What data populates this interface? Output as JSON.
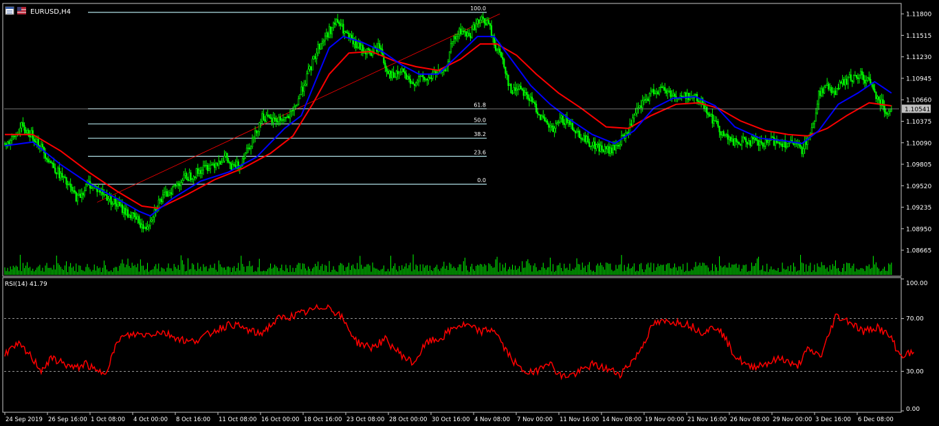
{
  "window": {
    "title": "EURUSD,H4",
    "icons": [
      "chart-window-icon",
      "flag-icon"
    ]
  },
  "colors": {
    "background": "#000000",
    "frame": "#c8c8c8",
    "candle_up": "#00ff00",
    "candle_down": "#00ff00",
    "ma_fast": "#0000ff",
    "ma_slow": "#ff0000",
    "fib": "#b0e0e6",
    "trendline": "#ff0000",
    "rsi": "#ff0000",
    "volume": "#00ff00",
    "price_tag_bg": "#c0c0c0",
    "text": "#ffffff"
  },
  "chart_data": {
    "type": "candlestick",
    "symbol": "EURUSD",
    "timeframe": "H4",
    "ylim": [
      1.0852,
      1.1192
    ],
    "price_ticks": [
      "1.11800",
      "1.11515",
      "1.11230",
      "1.10945",
      "1.10660",
      "1.10375",
      "1.10090",
      "1.09805",
      "1.09520",
      "1.09235",
      "1.08950",
      "1.08665"
    ],
    "current_price": "1.10541",
    "time_labels": [
      "24 Sep 2019",
      "26 Sep 16:00",
      "1 Oct 08:00",
      "4 Oct 00:00",
      "8 Oct 16:00",
      "11 Oct 08:00",
      "16 Oct 00:00",
      "18 Oct 16:00",
      "23 Oct 08:00",
      "28 Oct 00:00",
      "30 Oct 16:00",
      "4 Nov 08:00",
      "7 Nov 00:00",
      "11 Nov 16:00",
      "14 Nov 08:00",
      "19 Nov 00:00",
      "21 Nov 16:00",
      "26 Nov 08:00",
      "29 Nov 00:00",
      "3 Dec 16:00",
      "6 Dec 08:00"
    ],
    "price_path": [
      [
        0,
        1.1008
      ],
      [
        5,
        1.1012
      ],
      [
        12,
        1.103
      ],
      [
        22,
        1.1015
      ],
      [
        32,
        1.0985
      ],
      [
        42,
        1.096
      ],
      [
        52,
        1.0935
      ],
      [
        60,
        1.0955
      ],
      [
        68,
        1.0945
      ],
      [
        78,
        1.093
      ],
      [
        88,
        1.0915
      ],
      [
        96,
        1.0905
      ],
      [
        100,
        1.0893
      ],
      [
        104,
        1.0908
      ],
      [
        110,
        1.093
      ],
      [
        118,
        1.0945
      ],
      [
        128,
        1.0962
      ],
      [
        136,
        1.0968
      ],
      [
        142,
        1.0975
      ],
      [
        150,
        1.0982
      ],
      [
        158,
        1.099
      ],
      [
        162,
        1.0975
      ],
      [
        168,
        1.098
      ],
      [
        172,
        1.0998
      ],
      [
        178,
        1.1015
      ],
      [
        184,
        1.1045
      ],
      [
        190,
        1.1038
      ],
      [
        196,
        1.104
      ],
      [
        202,
        1.1042
      ],
      [
        206,
        1.1048
      ],
      [
        210,
        1.1068
      ],
      [
        214,
        1.1088
      ],
      [
        218,
        1.1105
      ],
      [
        224,
        1.1135
      ],
      [
        230,
        1.1152
      ],
      [
        234,
        1.1162
      ],
      [
        238,
        1.117
      ],
      [
        244,
        1.1152
      ],
      [
        250,
        1.114
      ],
      [
        256,
        1.1132
      ],
      [
        262,
        1.1128
      ],
      [
        268,
        1.1138
      ],
      [
        272,
        1.111
      ],
      [
        278,
        1.1095
      ],
      [
        284,
        1.1105
      ],
      [
        290,
        1.1085
      ],
      [
        296,
        1.1095
      ],
      [
        302,
        1.1092
      ],
      [
        308,
        1.1102
      ],
      [
        314,
        1.11
      ],
      [
        320,
        1.1142
      ],
      [
        326,
        1.1158
      ],
      [
        332,
        1.115
      ],
      [
        336,
        1.1165
      ],
      [
        342,
        1.1172
      ],
      [
        346,
        1.1166
      ],
      [
        350,
        1.114
      ],
      [
        356,
        1.112
      ],
      [
        362,
        1.1075
      ],
      [
        368,
        1.1085
      ],
      [
        374,
        1.107
      ],
      [
        380,
        1.1055
      ],
      [
        386,
        1.1035
      ],
      [
        392,
        1.1025
      ],
      [
        398,
        1.104
      ],
      [
        404,
        1.1035
      ],
      [
        410,
        1.1022
      ],
      [
        416,
        1.1012
      ],
      [
        422,
        1.1005
      ],
      [
        428,
        1.1
      ],
      [
        434,
        1.0998
      ],
      [
        440,
        1.101
      ],
      [
        446,
        1.1025
      ],
      [
        452,
        1.105
      ],
      [
        458,
        1.1065
      ],
      [
        464,
        1.1078
      ],
      [
        470,
        1.108
      ],
      [
        476,
        1.1075
      ],
      [
        482,
        1.1068
      ],
      [
        488,
        1.1072
      ],
      [
        494,
        1.1068
      ],
      [
        500,
        1.106
      ],
      [
        506,
        1.104
      ],
      [
        512,
        1.1025
      ],
      [
        518,
        1.1012
      ],
      [
        524,
        1.1008
      ],
      [
        530,
        1.1012
      ],
      [
        536,
        1.101
      ],
      [
        542,
        1.1005
      ],
      [
        548,
        1.1012
      ],
      [
        554,
        1.101
      ],
      [
        560,
        1.1008
      ],
      [
        566,
        1.1005
      ],
      [
        570,
        1.1
      ],
      [
        574,
        1.1015
      ],
      [
        578,
        1.103
      ],
      [
        582,
        1.1075
      ],
      [
        588,
        1.1082
      ],
      [
        594,
        1.1078
      ],
      [
        600,
        1.109
      ],
      [
        606,
        1.1095
      ],
      [
        612,
        1.1098
      ],
      [
        618,
        1.109
      ],
      [
        624,
        1.107
      ],
      [
        630,
        1.1052
      ],
      [
        634,
        1.1054
      ]
    ],
    "ma_fast_path": [
      [
        0,
        1.1005
      ],
      [
        20,
        1.101
      ],
      [
        40,
        1.098
      ],
      [
        60,
        1.0955
      ],
      [
        80,
        1.0935
      ],
      [
        96,
        1.0918
      ],
      [
        104,
        1.0912
      ],
      [
        120,
        1.0935
      ],
      [
        140,
        1.0958
      ],
      [
        160,
        1.097
      ],
      [
        180,
        1.099
      ],
      [
        200,
        1.1028
      ],
      [
        212,
        1.1045
      ],
      [
        222,
        1.109
      ],
      [
        232,
        1.1135
      ],
      [
        242,
        1.115
      ],
      [
        256,
        1.1142
      ],
      [
        270,
        1.113
      ],
      [
        284,
        1.1112
      ],
      [
        296,
        1.11
      ],
      [
        310,
        1.11
      ],
      [
        324,
        1.1125
      ],
      [
        338,
        1.115
      ],
      [
        350,
        1.115
      ],
      [
        362,
        1.112
      ],
      [
        376,
        1.1085
      ],
      [
        390,
        1.106
      ],
      [
        404,
        1.104
      ],
      [
        420,
        1.102
      ],
      [
        436,
        1.1008
      ],
      [
        450,
        1.1025
      ],
      [
        464,
        1.1055
      ],
      [
        478,
        1.1068
      ],
      [
        494,
        1.107
      ],
      [
        508,
        1.1058
      ],
      [
        522,
        1.103
      ],
      [
        540,
        1.1015
      ],
      [
        556,
        1.1012
      ],
      [
        570,
        1.1008
      ],
      [
        582,
        1.1025
      ],
      [
        596,
        1.106
      ],
      [
        610,
        1.1075
      ],
      [
        622,
        1.109
      ],
      [
        634,
        1.1075
      ]
    ],
    "ma_slow_path": [
      [
        0,
        1.102
      ],
      [
        20,
        1.102
      ],
      [
        40,
        1.0998
      ],
      [
        60,
        1.097
      ],
      [
        80,
        1.0945
      ],
      [
        98,
        1.0925
      ],
      [
        110,
        1.0922
      ],
      [
        130,
        1.094
      ],
      [
        150,
        1.096
      ],
      [
        170,
        1.0975
      ],
      [
        190,
        1.0995
      ],
      [
        206,
        1.1018
      ],
      [
        220,
        1.106
      ],
      [
        232,
        1.11
      ],
      [
        246,
        1.1128
      ],
      [
        262,
        1.113
      ],
      [
        278,
        1.1118
      ],
      [
        294,
        1.111
      ],
      [
        310,
        1.1105
      ],
      [
        326,
        1.112
      ],
      [
        340,
        1.114
      ],
      [
        352,
        1.114
      ],
      [
        366,
        1.1125
      ],
      [
        380,
        1.11
      ],
      [
        396,
        1.1075
      ],
      [
        412,
        1.1055
      ],
      [
        430,
        1.103
      ],
      [
        446,
        1.1028
      ],
      [
        462,
        1.1045
      ],
      [
        480,
        1.106
      ],
      [
        496,
        1.1062
      ],
      [
        510,
        1.1055
      ],
      [
        526,
        1.1038
      ],
      [
        544,
        1.1025
      ],
      [
        560,
        1.102
      ],
      [
        574,
        1.1018
      ],
      [
        588,
        1.1028
      ],
      [
        602,
        1.1045
      ],
      [
        618,
        1.1062
      ],
      [
        634,
        1.1058
      ]
    ],
    "fibonacci": [
      {
        "level": "100.0",
        "price": 1.1182
      },
      {
        "level": "61.8",
        "price": 1.1054
      },
      {
        "level": "50.0",
        "price": 1.1034
      },
      {
        "level": "38.2",
        "price": 1.1015
      },
      {
        "level": "23.6",
        "price": 1.0991
      },
      {
        "level": "0.0",
        "price": 1.0954
      }
    ],
    "trendline": {
      "from": [
        66,
        1.093
      ],
      "to": [
        354,
        1.118
      ]
    },
    "indicator": {
      "label": "RSI(14) 41.79",
      "ylim": [
        0,
        100
      ],
      "ticks": [
        "100.00",
        "70.00",
        "30.00",
        "0.00"
      ],
      "levels": [
        70,
        30
      ],
      "path": [
        [
          0,
          44
        ],
        [
          10,
          50
        ],
        [
          18,
          42
        ],
        [
          26,
          31
        ],
        [
          34,
          40
        ],
        [
          42,
          36
        ],
        [
          50,
          32
        ],
        [
          58,
          36
        ],
        [
          66,
          29
        ],
        [
          72,
          30
        ],
        [
          82,
          55
        ],
        [
          92,
          58
        ],
        [
          102,
          58
        ],
        [
          112,
          60
        ],
        [
          122,
          56
        ],
        [
          132,
          52
        ],
        [
          142,
          56
        ],
        [
          152,
          62
        ],
        [
          162,
          66
        ],
        [
          172,
          62
        ],
        [
          182,
          58
        ],
        [
          196,
          70
        ],
        [
          206,
          72
        ],
        [
          216,
          75
        ],
        [
          230,
          80
        ],
        [
          240,
          72
        ],
        [
          252,
          52
        ],
        [
          262,
          48
        ],
        [
          272,
          54
        ],
        [
          282,
          44
        ],
        [
          292,
          36
        ],
        [
          302,
          52
        ],
        [
          312,
          55
        ],
        [
          322,
          64
        ],
        [
          330,
          65
        ],
        [
          340,
          60
        ],
        [
          350,
          62
        ],
        [
          358,
          46
        ],
        [
          368,
          32
        ],
        [
          378,
          28
        ],
        [
          388,
          38
        ],
        [
          398,
          26
        ],
        [
          408,
          28
        ],
        [
          420,
          35
        ],
        [
          430,
          32
        ],
        [
          440,
          28
        ],
        [
          452,
          42
        ],
        [
          464,
          66
        ],
        [
          476,
          68
        ],
        [
          488,
          66
        ],
        [
          498,
          60
        ],
        [
          510,
          64
        ],
        [
          522,
          42
        ],
        [
          532,
          33
        ],
        [
          544,
          36
        ],
        [
          556,
          40
        ],
        [
          566,
          33
        ],
        [
          574,
          46
        ],
        [
          584,
          42
        ],
        [
          594,
          72
        ],
        [
          604,
          68
        ],
        [
          614,
          60
        ],
        [
          624,
          64
        ],
        [
          634,
          55
        ],
        [
          640,
          42
        ],
        [
          650,
          44
        ]
      ]
    }
  }
}
